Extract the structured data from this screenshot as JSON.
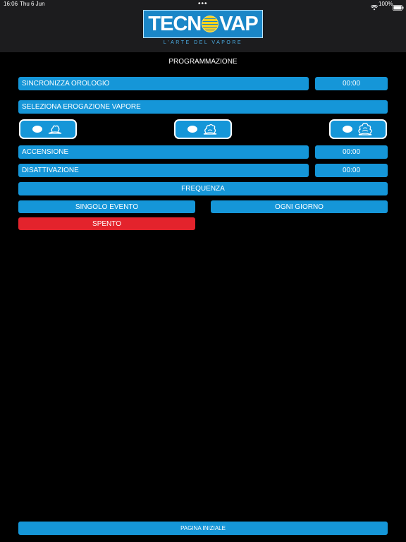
{
  "status_bar": {
    "time": "16:06",
    "date": "Thu 6 Jun",
    "dots": "•••",
    "battery": "100%"
  },
  "brand": {
    "logo_left": "TECN",
    "logo_right": "VAP",
    "tagline": "L'ARTE DEL VAPORE"
  },
  "page_title": "PROGRAMMAZIONE",
  "sync_clock": {
    "label": "SINCRONIZZA OROLOGIO",
    "value": "00:00"
  },
  "steam_select": {
    "label": "SELEZIONA EROGAZIONE VAPORE"
  },
  "steam_levels": [
    {
      "icon": "steam-low-icon"
    },
    {
      "icon": "steam-medium-icon"
    },
    {
      "icon": "steam-high-icon"
    }
  ],
  "power_on": {
    "label": "ACCENSIONE",
    "value": "00:00"
  },
  "power_off": {
    "label": "DISATTIVAZIONE",
    "value": "00:00"
  },
  "frequency": {
    "label": "FREQUENZA",
    "single_event": "SINGOLO EVENTO",
    "every_day": "OGNI GIORNO",
    "state": "SPENTO"
  },
  "footer": {
    "home_label": "PAGINA INIZIALE"
  },
  "colors": {
    "accent": "#1596d8",
    "off_state": "#e3232c",
    "background": "#000000",
    "header": "#1c1c1e"
  }
}
